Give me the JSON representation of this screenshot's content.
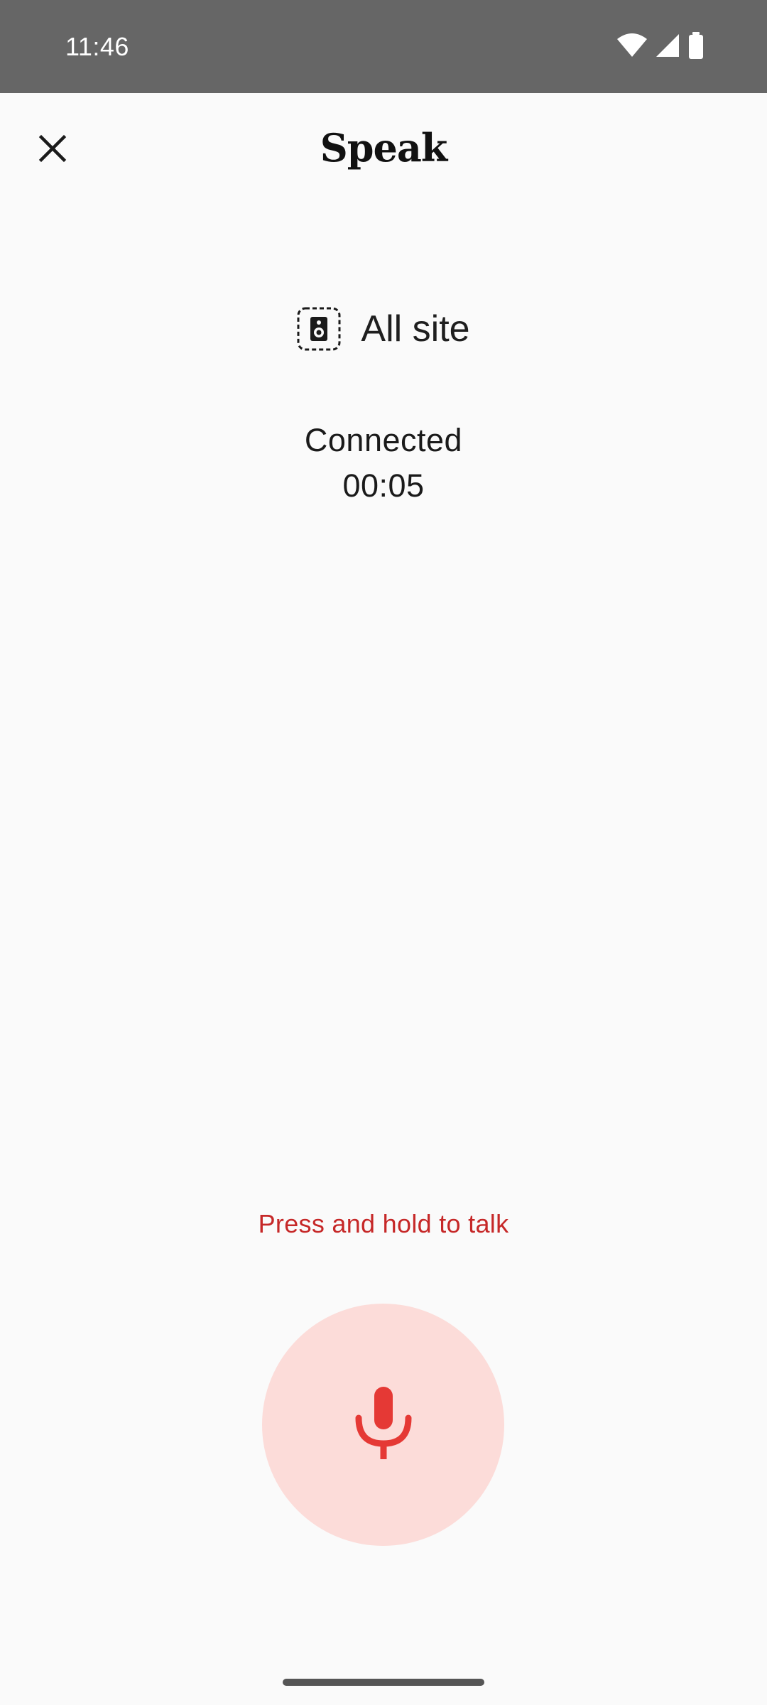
{
  "status_bar": {
    "time": "11:46",
    "icons": [
      "wifi-icon",
      "cell-signal-icon",
      "battery-icon"
    ]
  },
  "header": {
    "title": "Speak",
    "close_icon": "close-icon"
  },
  "target": {
    "icon": "speaker-icon",
    "label": "All site"
  },
  "connection": {
    "status": "Connected",
    "elapsed": "00:05"
  },
  "talk": {
    "hint": "Press and hold to talk",
    "icon": "microphone-icon"
  },
  "colors": {
    "status_bar_bg": "#666666",
    "background": "#fafafa",
    "accent_red": "#e53935",
    "hint_red": "#c62828",
    "mic_button_bg": "#fcdcd9"
  }
}
